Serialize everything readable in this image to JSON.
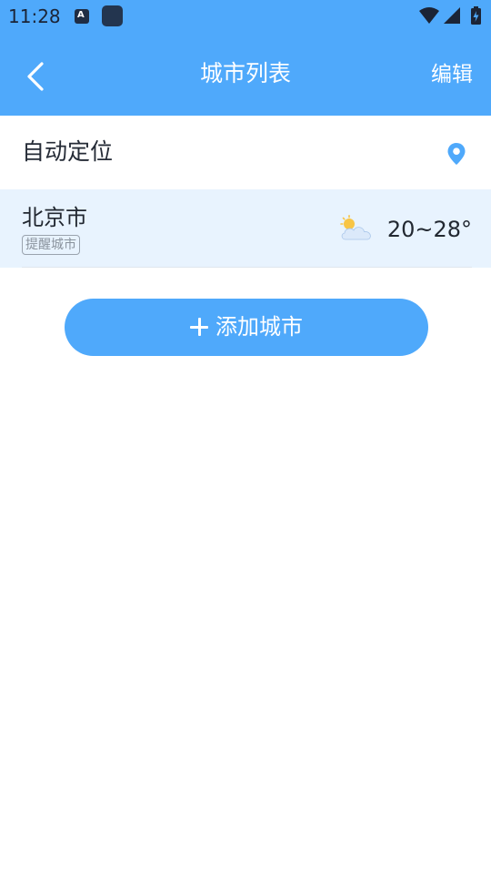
{
  "status_bar": {
    "time": "11:28",
    "a_glyph": "A"
  },
  "nav": {
    "title": "城市列表",
    "edit_label": "编辑",
    "back_icon": "chevron-left-icon"
  },
  "auto_location": {
    "label": "自动定位",
    "icon": "location-pin-icon"
  },
  "cities": [
    {
      "name": "北京市",
      "tag": "提醒城市",
      "weather_icon": "partly-cloudy-icon",
      "temperature": "20~28°"
    }
  ],
  "add_city": {
    "label": "添加城市"
  },
  "colors": {
    "primary": "#4fa9fb",
    "selected_row": "#e8f3fe",
    "text": "#222831"
  }
}
